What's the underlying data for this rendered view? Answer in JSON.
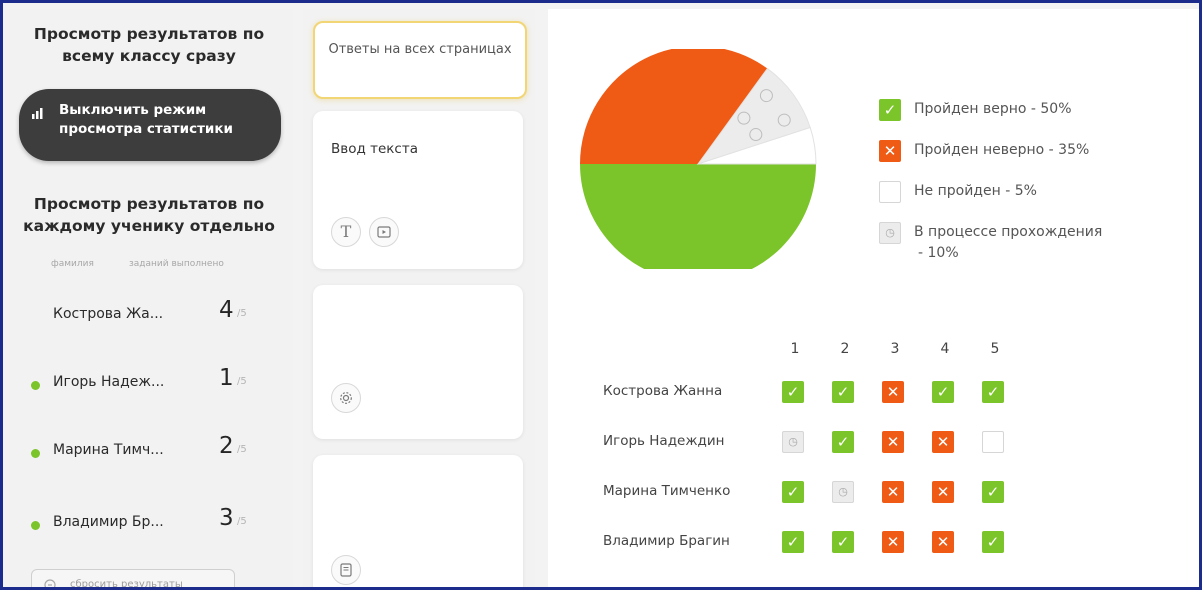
{
  "left": {
    "class_view_title": "Просмотр результатов по всему классу сразу",
    "stats_toggle_label": "Выключить режим просмотра статистики",
    "student_view_title": "Просмотр результатов по каждому ученику отдельно",
    "col_surname": "фамилия",
    "col_done": "заданий выполнено",
    "students": [
      {
        "name": "Кострова Жа...",
        "score": "4",
        "out_of": "/5",
        "online": false
      },
      {
        "name": "Игорь Надеж...",
        "score": "1",
        "out_of": "/5",
        "online": true
      },
      {
        "name": "Марина Тимч...",
        "score": "2",
        "out_of": "/5",
        "online": true
      },
      {
        "name": "Владимир Бр...",
        "score": "3",
        "out_of": "/5",
        "online": true
      }
    ],
    "reset_label": "сбросить результаты"
  },
  "middle": {
    "cards": [
      {
        "label": "Ответы на всех страницах",
        "active": true
      },
      {
        "label": "Ввод текста",
        "icons": [
          "text-icon",
          "media-icon"
        ]
      },
      {
        "label": "",
        "icons": [
          "settings-icon"
        ]
      },
      {
        "label": "",
        "icons": [
          "document-icon"
        ]
      }
    ]
  },
  "chart_data": {
    "type": "pie",
    "slices": [
      {
        "label": "Пройден верно - 50%",
        "value": 50,
        "color": "#7bc429"
      },
      {
        "label": "Пройден неверно - 35%",
        "value": 35,
        "color": "#ef5a15"
      },
      {
        "label": "Не пройден - 5%",
        "value": 5,
        "color": "#ffffff"
      },
      {
        "label": "В процессе прохождения - 10%",
        "value": 10,
        "color": "#ececec"
      }
    ]
  },
  "legend": {
    "correct": "Пройден верно - 50%",
    "wrong": "Пройден неверно - 35%",
    "not_done": "Не пройден - 5%",
    "in_progress_line1": "В процессе прохождения",
    "in_progress_line2": "- 10%"
  },
  "results": {
    "columns": [
      "1",
      "2",
      "3",
      "4",
      "5"
    ],
    "rows": [
      {
        "name": "Кострова Жанна",
        "cells": [
          "correct",
          "correct",
          "wrong",
          "correct",
          "correct"
        ]
      },
      {
        "name": "Игорь Надеждин",
        "cells": [
          "progress",
          "correct",
          "wrong",
          "wrong",
          "none"
        ]
      },
      {
        "name": "Марина Тимченко",
        "cells": [
          "correct",
          "progress",
          "wrong",
          "wrong",
          "correct"
        ]
      },
      {
        "name": "Владимир Брагин",
        "cells": [
          "correct",
          "correct",
          "wrong",
          "wrong",
          "correct"
        ]
      }
    ]
  },
  "colors": {
    "correct": "#7bc429",
    "wrong": "#ef5a15",
    "active_card_border": "#f2d574",
    "dark_button": "#3d3d3d"
  }
}
